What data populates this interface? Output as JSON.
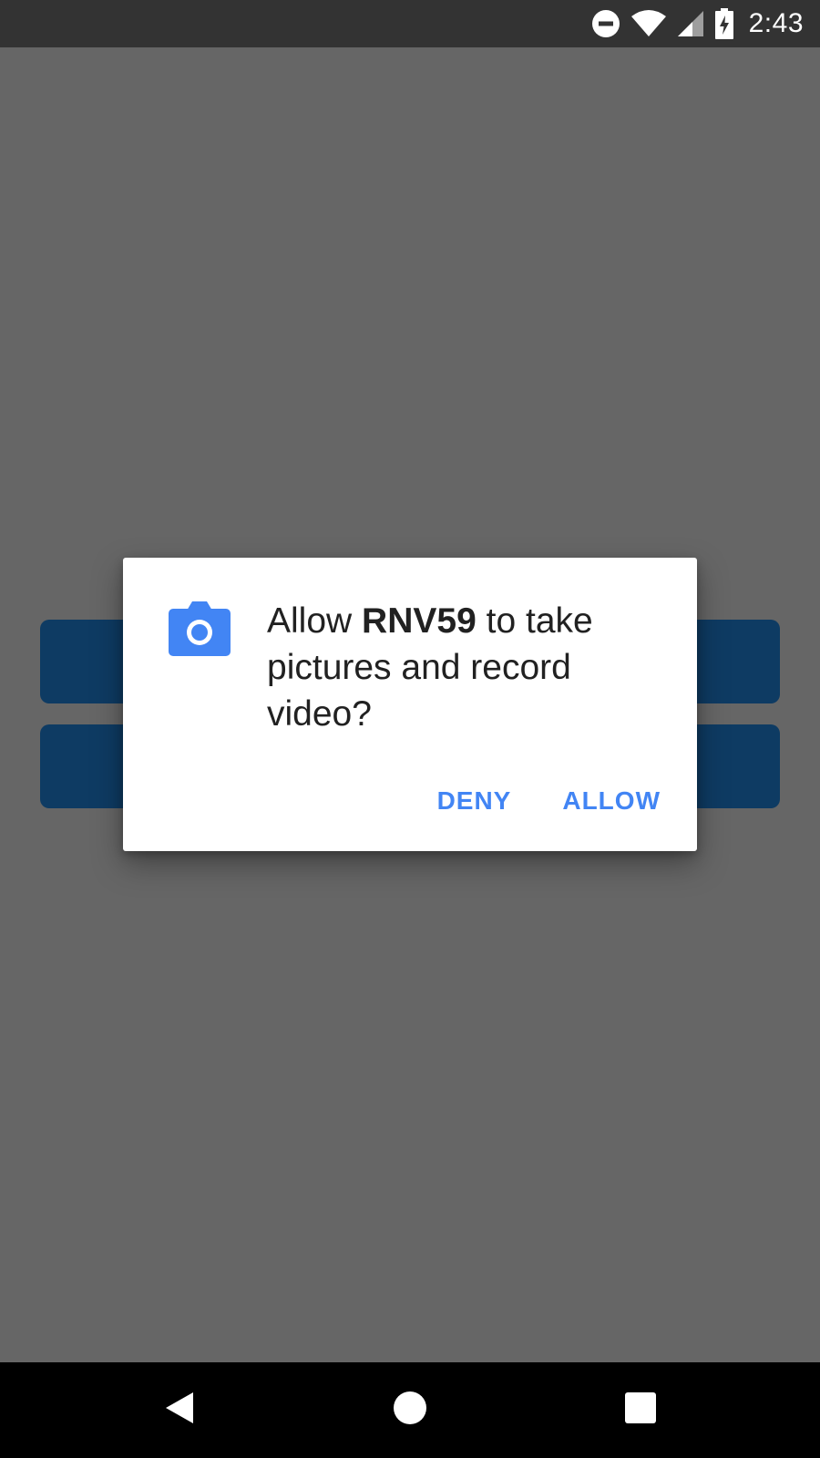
{
  "status_bar": {
    "time": "2:43",
    "icons": [
      "do-not-disturb-icon",
      "wifi-icon",
      "cell-signal-icon",
      "battery-charging-icon"
    ]
  },
  "dialog": {
    "message_prefix": "Allow ",
    "app_name": "RNV59",
    "message_suffix": " to take pictures and record video?",
    "icon": "camera-icon",
    "deny_label": "DENY",
    "allow_label": "ALLOW"
  },
  "nav_bar": {
    "icons": [
      "back-icon",
      "home-icon",
      "recents-icon"
    ]
  },
  "colors": {
    "accent": "#4285f4",
    "app_button": "#0e3b63",
    "scrim_background": "#666666",
    "status_bar": "#333333",
    "nav_bar": "#000000"
  }
}
